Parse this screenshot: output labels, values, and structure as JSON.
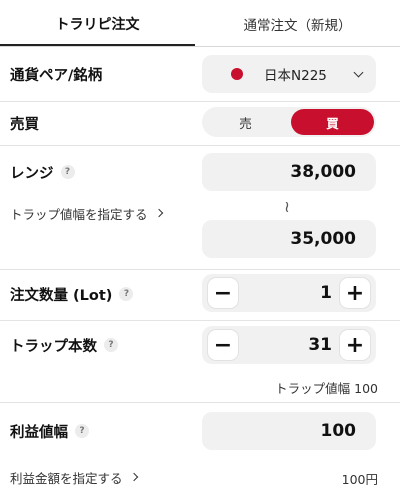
{
  "tabs": [
    {
      "label": "トラリピ注文"
    },
    {
      "label": "通常注文（新規）"
    }
  ],
  "symbol": {
    "label": "通貨ペア/銘柄",
    "value": "日本N225",
    "flag_color": "#c8102e"
  },
  "side": {
    "label": "売買",
    "sell_label": "売",
    "buy_label": "買",
    "selected": "買",
    "accent": "#c8102e"
  },
  "range": {
    "label": "レンジ",
    "upper": "38,000",
    "lower": "35,000",
    "separator": "≀",
    "trap_width_link": "トラップ値幅を指定する"
  },
  "order_qty": {
    "label": "注文数量 (Lot)",
    "value": "1"
  },
  "trap_count": {
    "label": "トラップ本数",
    "value": "31",
    "note": "トラップ値幅 100"
  },
  "profit_width": {
    "label": "利益値幅",
    "value": "100",
    "amount_link": "利益金額を指定する",
    "amount_value": "100円"
  },
  "help_mark": "?",
  "minus": "−",
  "plus": "+"
}
